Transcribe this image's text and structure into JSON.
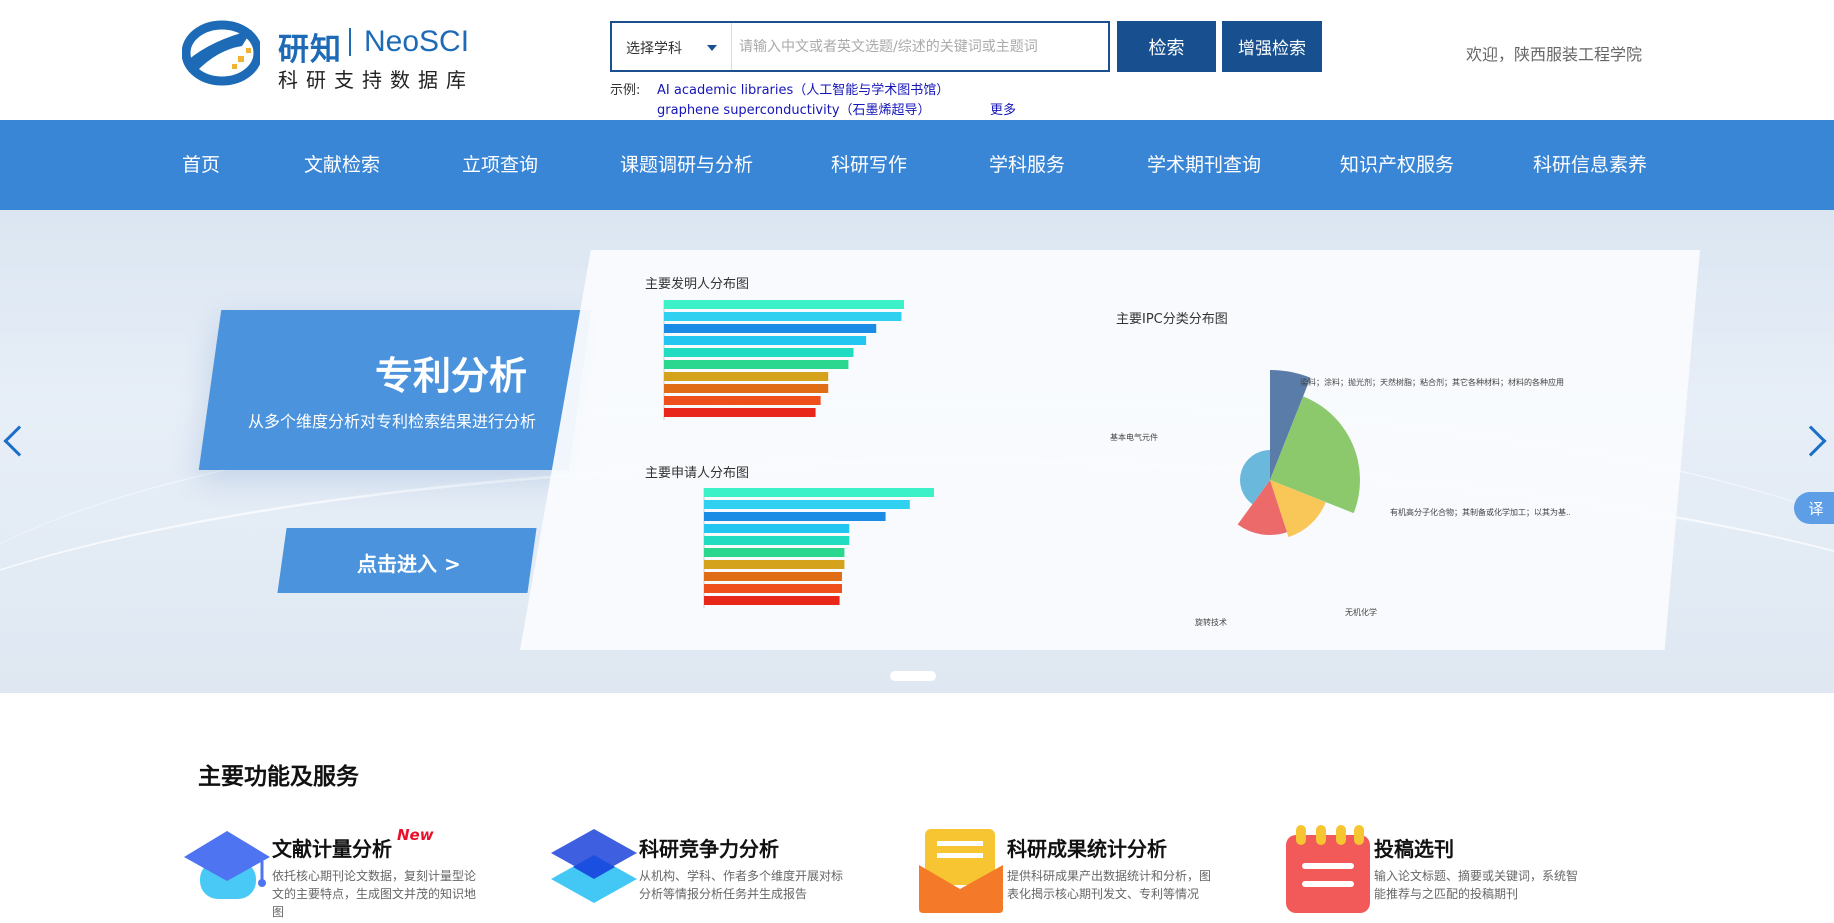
{
  "logo": {
    "cn": "研知",
    "en": "NeoSCI",
    "sub": "科研支持数据库"
  },
  "search": {
    "subject_label": "选择学科",
    "placeholder": "请输入中文或者英文选题/综述的关键词或主题词",
    "search_button": "检索",
    "advanced_button": "增强检索",
    "examples_label": "示例:",
    "examples": [
      "AI academic libraries（人工智能与学术图书馆）",
      "graphene superconductivity（石墨烯超导）"
    ],
    "more": "更多"
  },
  "welcome": "欢迎，陕西服装工程学院",
  "nav": [
    "首页",
    "文献检索",
    "立项查询",
    "课题调研与分析",
    "科研写作",
    "学科服务",
    "学术期刊查询",
    "知识产权服务",
    "科研信息素养"
  ],
  "banner": {
    "title": "专利分析",
    "subtitle": "从多个维度分析对专利检索结果进行分析",
    "enter": "点击进入 >",
    "translate": "译",
    "colors": {
      "nav": "#3a86d6",
      "button": "#174f8f",
      "panel": "#4b93dc"
    }
  },
  "chart_data": [
    {
      "type": "bar",
      "title": "主要发明人分布图",
      "values": [
        95,
        94,
        84,
        80,
        75,
        73,
        65,
        65,
        62,
        60
      ],
      "colors": [
        "#3cf0c8",
        "#2fd0f0",
        "#1b8ce6",
        "#23c6f0",
        "#22dcc1",
        "#2bd78f",
        "#d5a21c",
        "#e06d16",
        "#ef4f1a",
        "#e8261a"
      ]
    },
    {
      "type": "bar",
      "title": "主要申请人分布图",
      "values": [
        95,
        85,
        75,
        60,
        60,
        58,
        58,
        57,
        57,
        56
      ],
      "colors": [
        "#3cf0c8",
        "#2fd0f0",
        "#1b8ce6",
        "#23c6f0",
        "#22dcc1",
        "#2bd78f",
        "#d5a21c",
        "#e06d16",
        "#ef4f1a",
        "#e8261a"
      ]
    },
    {
      "type": "pie",
      "title": "主要IPC分类分布图",
      "slices": [
        {
          "name": "基本电气元件",
          "value": 40,
          "color": "#6ab8dc"
        },
        {
          "name": "有机高分子化合物；其制备或化学加工；以其为基...",
          "value": 25,
          "color": "#8bc96c"
        },
        {
          "name": "无机化学",
          "value": 14,
          "color": "#f8c758"
        },
        {
          "name": "旋转技术",
          "value": 15,
          "color": "#ec6a6a"
        },
        {
          "name": "染料；涂料；抛光剂；天然树脂；粘合剂；其它各种材料；材料的各种应用",
          "value": 6,
          "color": "#5a7ca8"
        }
      ]
    }
  ],
  "section": {
    "title": "主要功能及服务"
  },
  "features": [
    {
      "title": "文献计量分析",
      "badge": "New",
      "desc": "依托核心期刊论文数据，复刻计量型论文的主要特点，生成图文并茂的知识地图"
    },
    {
      "title": "科研竞争力分析",
      "desc": "从机构、学科、作者多个维度开展对标分析等情报分析任务并生成报告"
    },
    {
      "title": "科研成果统计分析",
      "desc": "提供科研成果产出数据统计和分析，图表化揭示核心期刊发文、专利等情况"
    },
    {
      "title": "投稿选刊",
      "desc": "输入论文标题、摘要或关键词，系统智能推荐与之匹配的投稿期刊"
    }
  ]
}
